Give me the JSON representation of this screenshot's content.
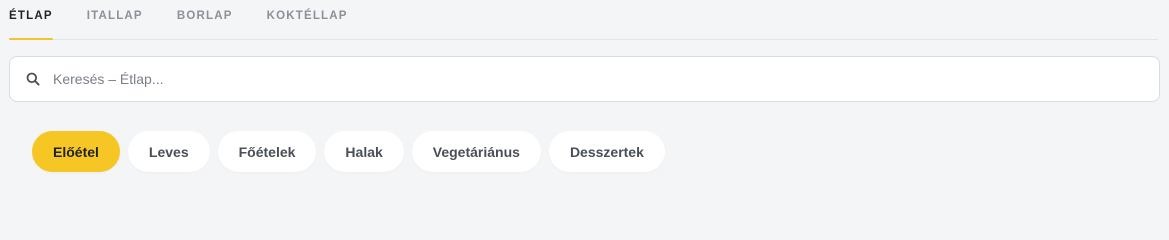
{
  "tabs": [
    {
      "label": "ÉTLAP",
      "active": true
    },
    {
      "label": "ITALLAP",
      "active": false
    },
    {
      "label": "BORLAP",
      "active": false
    },
    {
      "label": "KOKTÉLLAP",
      "active": false
    }
  ],
  "search": {
    "placeholder": "Keresés – Étlap...",
    "value": "",
    "icon": "search-icon"
  },
  "categories": [
    {
      "label": "Előétel",
      "active": true
    },
    {
      "label": "Leves",
      "active": false
    },
    {
      "label": "Főételek",
      "active": false
    },
    {
      "label": "Halak",
      "active": false
    },
    {
      "label": "Vegetáriánus",
      "active": false
    },
    {
      "label": "Desszertek",
      "active": false
    }
  ],
  "colors": {
    "accent": "#f6c624",
    "background": "#f4f5f7",
    "tab_active_text": "#1f2328",
    "tab_inactive_text": "#8b9099"
  }
}
